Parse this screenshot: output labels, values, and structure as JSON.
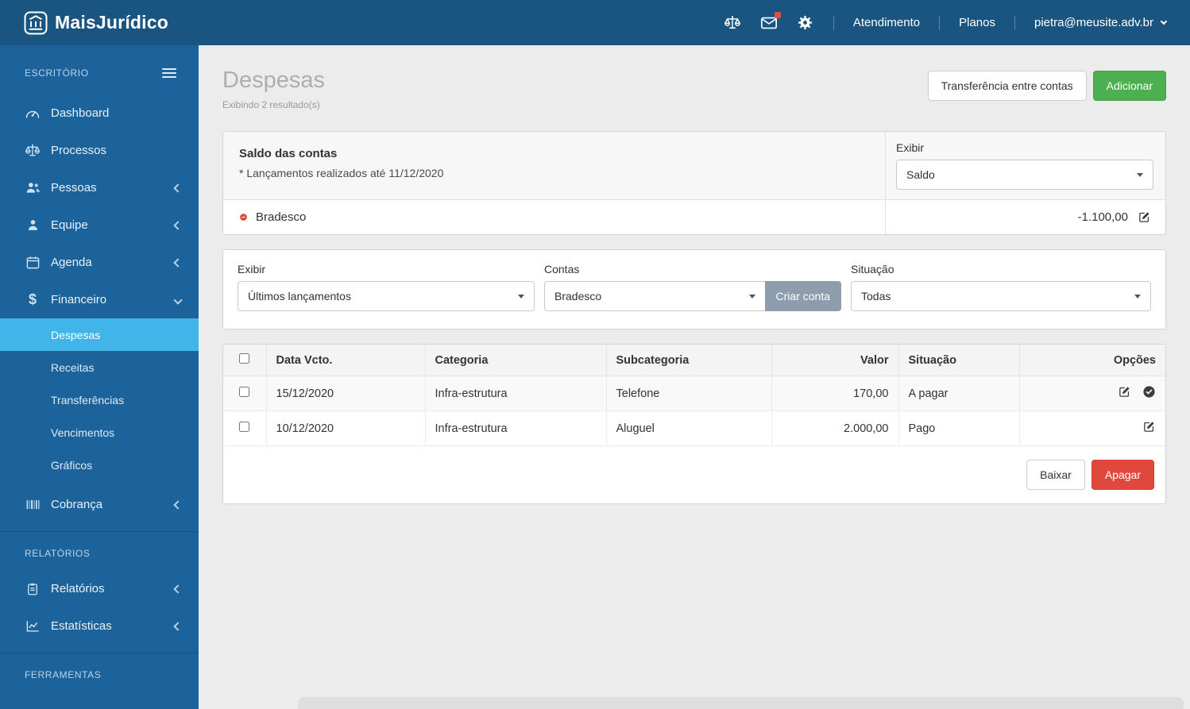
{
  "topbar": {
    "brand": "MaisJurídico",
    "nav": {
      "atendimento": "Atendimento",
      "planos": "Planos",
      "user_email": "pietra@meusite.adv.br"
    }
  },
  "sidebar": {
    "section_escritorio": "ESCRITÓRIO",
    "section_relatorios": "RELATÓRIOS",
    "section_ferramentas": "FERRAMENTAS",
    "items": {
      "dashboard": "Dashboard",
      "processos": "Processos",
      "pessoas": "Pessoas",
      "equipe": "Equipe",
      "agenda": "Agenda",
      "financeiro": "Financeiro",
      "cobranca": "Cobrança",
      "relatorios": "Relatórios",
      "estatisticas": "Estatísticas"
    },
    "financeiro_submenu": {
      "despesas": "Despesas",
      "receitas": "Receitas",
      "transferencias": "Transferências",
      "vencimentos": "Vencimentos",
      "graficos": "Gráficos"
    }
  },
  "page": {
    "title": "Despesas",
    "subtitle": "Exibindo 2 resultado(s)",
    "transfer_button": "Transferência entre contas",
    "add_button": "Adicionar"
  },
  "balance_card": {
    "title": "Saldo das contas",
    "note": "* Lançamentos realizados até 11/12/2020",
    "exibir_label": "Exibir",
    "exibir_value": "Saldo",
    "account_name": "Bradesco",
    "account_balance": "-1.100,00"
  },
  "filters": {
    "exibir_label": "Exibir",
    "exibir_value": "Últimos lançamentos",
    "contas_label": "Contas",
    "contas_value": "Bradesco",
    "criar_conta_button": "Criar conta",
    "situacao_label": "Situação",
    "situacao_value": "Todas"
  },
  "table": {
    "headers": {
      "data": "Data Vcto.",
      "categoria": "Categoria",
      "subcategoria": "Subcategoria",
      "valor": "Valor",
      "situacao": "Situação",
      "opcoes": "Opções"
    },
    "rows": [
      {
        "date": "15/12/2020",
        "category": "Infra-estrutura",
        "subcategory": "Telefone",
        "value": "170,00",
        "status": "A pagar"
      },
      {
        "date": "10/12/2020",
        "category": "Infra-estrutura",
        "subcategory": "Aluguel",
        "value": "2.000,00",
        "status": "Pago"
      }
    ],
    "baixar_button": "Baixar",
    "apagar_button": "Apagar"
  },
  "colors": {
    "topbar_blue": "#1a5480",
    "sidebar_blue": "#1d639b",
    "active_item_blue": "#41b4ea",
    "add_green": "#4caf50",
    "delete_red": "#e0483e",
    "criar_conta_slate": "#8d9dad",
    "notification_red": "#e74c3c",
    "negative_dot_red": "#dd4b39"
  }
}
